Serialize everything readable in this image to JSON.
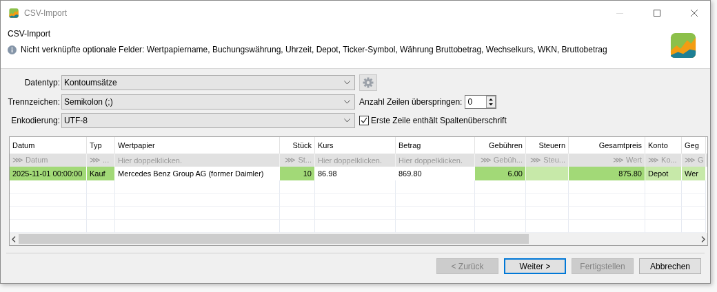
{
  "window": {
    "title": "CSV-Import"
  },
  "header": {
    "title": "CSV-Import",
    "message": "Nicht verknüpfte optionale Felder: Wertpapiername, Buchungswährung, Uhrzeit, Depot, Ticker-Symbol, Währung Bruttobetrag, Wechselkurs, WKN, Bruttobetrag"
  },
  "form": {
    "data_type": {
      "label": "Datentyp:",
      "value": "Kontoumsätze"
    },
    "separator": {
      "label": "Trennzeichen:",
      "value": "Semikolon (;)"
    },
    "skip_lines": {
      "label": "Anzahl Zeilen überspringen:",
      "value": "0"
    },
    "encoding": {
      "label": "Enkodierung:",
      "value": "UTF-8"
    },
    "header_checkbox": {
      "label": "Erste Zeile enthält Spaltenüberschrift",
      "checked": true
    }
  },
  "table": {
    "columns": [
      {
        "label": "Datum",
        "mapping": "⋙ Datum"
      },
      {
        "label": "Typ",
        "mapping": "⋙ ..."
      },
      {
        "label": "Wertpapier",
        "mapping": "Hier doppelklicken."
      },
      {
        "label": "Stück",
        "mapping": "⋙ St..."
      },
      {
        "label": "Kurs",
        "mapping": "Hier doppelklicken."
      },
      {
        "label": "Betrag",
        "mapping": "Hier doppelklicken."
      },
      {
        "label": "Gebühren",
        "mapping": "⋙ Gebüh..."
      },
      {
        "label": "Steuern",
        "mapping": "⋙ Steu..."
      },
      {
        "label": "Gesamtpreis",
        "mapping": "⋙ Wert"
      },
      {
        "label": "Konto",
        "mapping": "⋙ Ko..."
      },
      {
        "label": "Geg",
        "mapping": "⋙ G"
      }
    ],
    "rows": [
      {
        "cells": [
          {
            "text": "2025-11-01 00:00:00",
            "color": "#a2d977"
          },
          {
            "text": "Kauf",
            "color": "#a2d977"
          },
          {
            "text": "Mercedes Benz Group AG (former Daimler)"
          },
          {
            "text": "10",
            "color": "#a2d977"
          },
          {
            "text": "86.98"
          },
          {
            "text": "869.80"
          },
          {
            "text": "6.00",
            "color": "#a2d977"
          },
          {
            "color": "#c7e9a9"
          },
          {
            "text": "875.80",
            "color": "#a2d977"
          },
          {
            "text": "Depot",
            "color": "#c7e9a9"
          },
          {
            "text": "Wer",
            "color": "#c7e9a9"
          }
        ]
      }
    ]
  },
  "buttons": [
    {
      "label": "< Zurück",
      "disabled": true,
      "default": false
    },
    {
      "label": "Weiter >",
      "disabled": false,
      "default": true
    },
    {
      "label": "Fertigstellen",
      "disabled": true,
      "default": false
    },
    {
      "label": "Abbrechen",
      "disabled": false,
      "default": false
    }
  ]
}
